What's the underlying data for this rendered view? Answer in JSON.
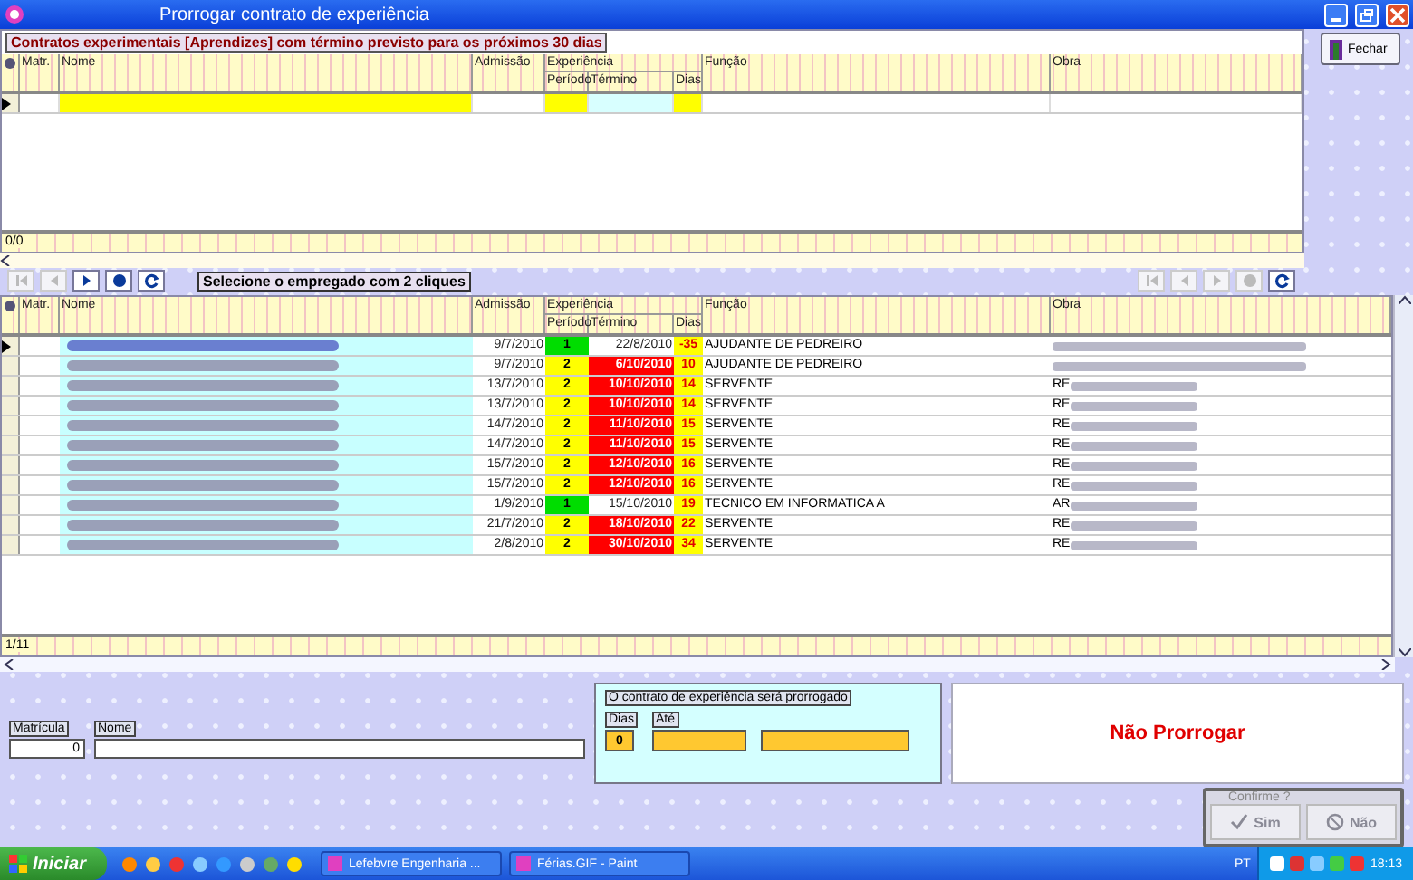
{
  "window": {
    "title": "Prorrogar contrato de experiência"
  },
  "close_button": {
    "label": "Fechar"
  },
  "upper_grid": {
    "caption": "Contratos  experimentais  [Aprendizes] com término previsto para os próximos 30 dias",
    "columns": {
      "matr": "Matr.",
      "nome": "Nome",
      "admissao": "Admissão",
      "experiencia": "Experiência",
      "periodo": "Período",
      "termino": "Término",
      "dias": "Dias",
      "funcao": "Função",
      "obra": "Obra"
    },
    "new_row": true,
    "record_count": "0/0"
  },
  "toolbar": {
    "left_buttons": [
      {
        "kind": "first",
        "disabled": true
      },
      {
        "kind": "prev",
        "disabled": true
      },
      {
        "kind": "next",
        "disabled": false
      },
      {
        "kind": "last",
        "disabled": false
      },
      {
        "kind": "refresh",
        "disabled": false
      }
    ],
    "hint": "Selecione o empregado com 2 cliques",
    "right_buttons": [
      {
        "kind": "first",
        "disabled": true
      },
      {
        "kind": "prev",
        "disabled": true
      },
      {
        "kind": "next",
        "disabled": true
      },
      {
        "kind": "last",
        "disabled": true
      },
      {
        "kind": "refresh",
        "disabled": false
      }
    ]
  },
  "lower_grid": {
    "columns": {
      "matr": "Matr.",
      "nome": "Nome",
      "admissao": "Admissão",
      "experiencia": "Experiência",
      "periodo": "Período",
      "termino": "Término",
      "dias": "Dias",
      "funcao": "Função",
      "obra": "Obra"
    },
    "rows": [
      {
        "selected": true,
        "admissao": "9/7/2010",
        "periodo": "1",
        "color": "#00dd00",
        "termino": "22/8/2010",
        "alert": false,
        "dias": "-35",
        "funcao": "AJUDANTE DE PEDREIRO"
      },
      {
        "selected": false,
        "admissao": "9/7/2010",
        "periodo": "2",
        "color": "#ffff00",
        "termino": "6/10/2010",
        "alert": true,
        "dias": "10",
        "funcao": "AJUDANTE DE PEDREIRO"
      },
      {
        "selected": false,
        "admissao": "13/7/2010",
        "periodo": "2",
        "color": "#ffff00",
        "termino": "10/10/2010",
        "alert": true,
        "dias": "14",
        "funcao": "SERVENTE",
        "obra": "RE"
      },
      {
        "selected": false,
        "admissao": "13/7/2010",
        "periodo": "2",
        "color": "#ffff00",
        "termino": "10/10/2010",
        "alert": true,
        "dias": "14",
        "funcao": "SERVENTE",
        "obra": "RE"
      },
      {
        "selected": false,
        "admissao": "14/7/2010",
        "periodo": "2",
        "color": "#ffff00",
        "termino": "11/10/2010",
        "alert": true,
        "dias": "15",
        "funcao": "SERVENTE",
        "obra": "RE"
      },
      {
        "selected": false,
        "admissao": "14/7/2010",
        "periodo": "2",
        "color": "#ffff00",
        "termino": "11/10/2010",
        "alert": true,
        "dias": "15",
        "funcao": "SERVENTE",
        "obra": "RE"
      },
      {
        "selected": false,
        "admissao": "15/7/2010",
        "periodo": "2",
        "color": "#ffff00",
        "termino": "12/10/2010",
        "alert": true,
        "dias": "16",
        "funcao": "SERVENTE",
        "obra": "RE"
      },
      {
        "selected": false,
        "admissao": "15/7/2010",
        "periodo": "2",
        "color": "#ffff00",
        "termino": "12/10/2010",
        "alert": true,
        "dias": "16",
        "funcao": "SERVENTE",
        "obra": "RE"
      },
      {
        "selected": false,
        "admissao": "1/9/2010",
        "periodo": "1",
        "color": "#00dd00",
        "termino": "15/10/2010",
        "alert": false,
        "dias": "19",
        "funcao": "TECNICO EM INFORMATICA A",
        "obra": "AR"
      },
      {
        "selected": false,
        "admissao": "21/7/2010",
        "periodo": "2",
        "color": "#ffff00",
        "termino": "18/10/2010",
        "alert": true,
        "dias": "22",
        "funcao": "SERVENTE",
        "obra": "RE"
      },
      {
        "selected": false,
        "admissao": "2/8/2010",
        "periodo": "2",
        "color": "#ffff00",
        "termino": "30/10/2010",
        "alert": true,
        "dias": "34",
        "funcao": "SERVENTE",
        "obra": "RE"
      }
    ],
    "record_count": "1/11"
  },
  "employee": {
    "matricula_label": "Matrícula",
    "matricula_value": "0",
    "nome_label": "Nome"
  },
  "contract_panel": {
    "title": "O contrato de experiência  será prorrogado",
    "dias_label": "Dias",
    "dias_value": "0",
    "ate_label": "Até"
  },
  "decision": {
    "text": "Não Prorrogar"
  },
  "confirm": {
    "title": "Confirme ?",
    "buttons": [
      {
        "kind": "yes",
        "label": "Sim",
        "disabled": true
      },
      {
        "kind": "no",
        "label": "Não",
        "disabled": true
      }
    ]
  },
  "taskbar": {
    "start": "Iniciar",
    "tasks": [
      {
        "label": "Lefebvre Engenharia ..."
      },
      {
        "label": "Férias.GIF - Paint"
      }
    ],
    "language": "PT",
    "clock": "18:13"
  }
}
